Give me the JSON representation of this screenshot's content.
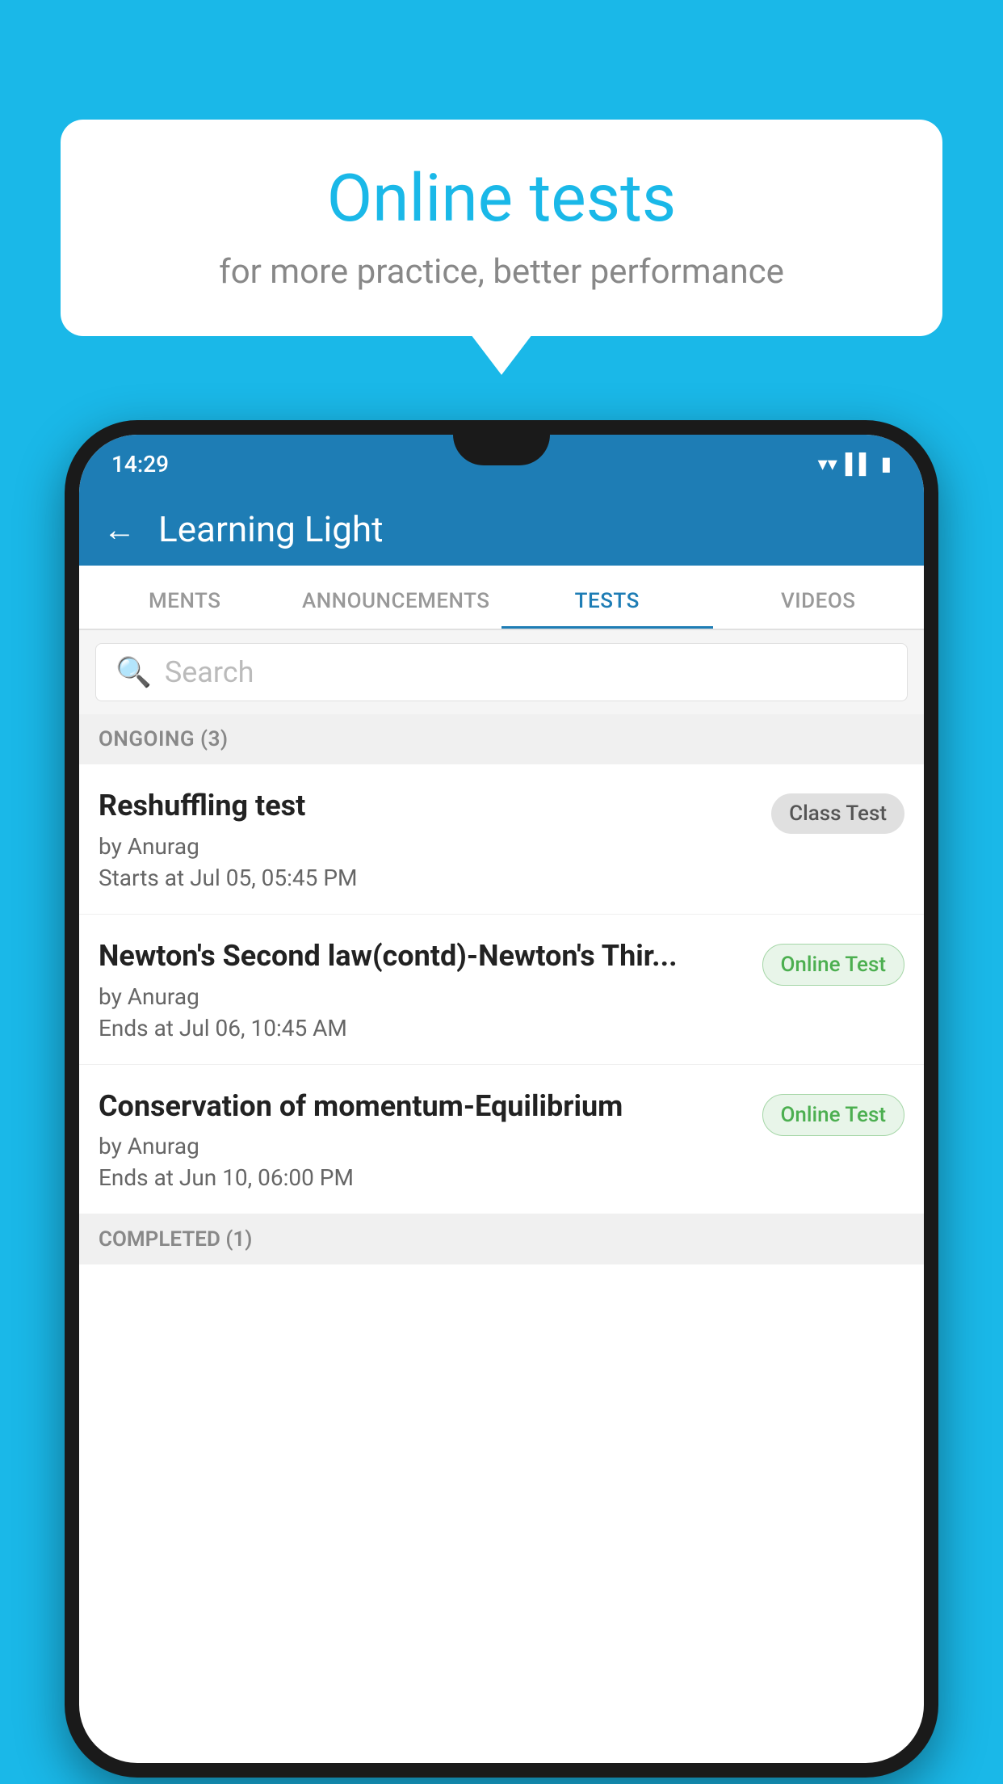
{
  "background_color": "#1ab8e8",
  "bubble": {
    "title": "Online tests",
    "subtitle": "for more practice, better performance"
  },
  "phone": {
    "status_bar": {
      "time": "14:29",
      "icons": [
        "wifi",
        "signal",
        "battery"
      ]
    },
    "header": {
      "back_label": "←",
      "title": "Learning Light"
    },
    "tabs": [
      {
        "label": "MENTS",
        "active": false
      },
      {
        "label": "ANNOUNCEMENTS",
        "active": false
      },
      {
        "label": "TESTS",
        "active": true
      },
      {
        "label": "VIDEOS",
        "active": false
      }
    ],
    "search": {
      "placeholder": "Search"
    },
    "sections": [
      {
        "heading": "ONGOING (3)",
        "items": [
          {
            "title": "Reshuffling test",
            "author": "by Anurag",
            "date": "Starts at  Jul 05, 05:45 PM",
            "badge": "Class Test",
            "badge_type": "class"
          },
          {
            "title": "Newton's Second law(contd)-Newton's Thir...",
            "author": "by Anurag",
            "date": "Ends at  Jul 06, 10:45 AM",
            "badge": "Online Test",
            "badge_type": "online"
          },
          {
            "title": "Conservation of momentum-Equilibrium",
            "author": "by Anurag",
            "date": "Ends at  Jun 10, 06:00 PM",
            "badge": "Online Test",
            "badge_type": "online"
          }
        ]
      },
      {
        "heading": "COMPLETED (1)",
        "items": []
      }
    ]
  }
}
